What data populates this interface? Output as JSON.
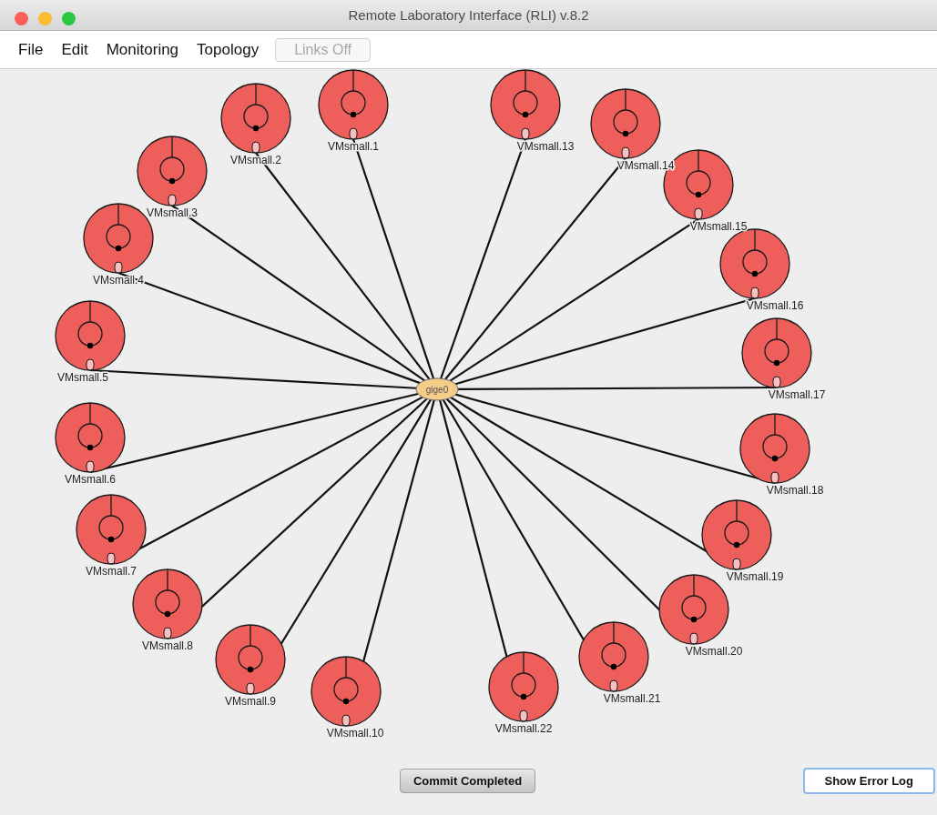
{
  "window": {
    "title": "Remote Laboratory Interface (RLI) v.8.2"
  },
  "menu": [
    {
      "label": "File"
    },
    {
      "label": "Edit"
    },
    {
      "label": "Monitoring"
    },
    {
      "label": "Topology"
    }
  ],
  "links_toggle": {
    "label": "Links Off",
    "disabled": true
  },
  "topology": {
    "hub": {
      "label": "gige0"
    },
    "nodes": [
      {
        "label": "VMsmall.1"
      },
      {
        "label": "VMsmall.13"
      },
      {
        "label": "VMsmall.2"
      },
      {
        "label": "VMsmall.14"
      },
      {
        "label": "VMsmall.3"
      },
      {
        "label": "VMsmall.15"
      },
      {
        "label": "VMsmall.4"
      },
      {
        "label": "VMsmall.16"
      },
      {
        "label": "VMsmall.5"
      },
      {
        "label": "VMsmall.17"
      },
      {
        "label": "VMsmall.6"
      },
      {
        "label": "VMsmall.18"
      },
      {
        "label": "VMsmall.7"
      },
      {
        "label": "VMsmall.19"
      },
      {
        "label": "VMsmall.8"
      },
      {
        "label": "VMsmall.20"
      },
      {
        "label": "VMsmall.9"
      },
      {
        "label": "VMsmall.21"
      },
      {
        "label": "VMsmall.10"
      },
      {
        "label": "VMsmall.22"
      }
    ]
  },
  "buttons": [
    {
      "label": "Commit Completed",
      "focused": false
    },
    {
      "label": "Show Error Log",
      "focused": true
    }
  ]
}
